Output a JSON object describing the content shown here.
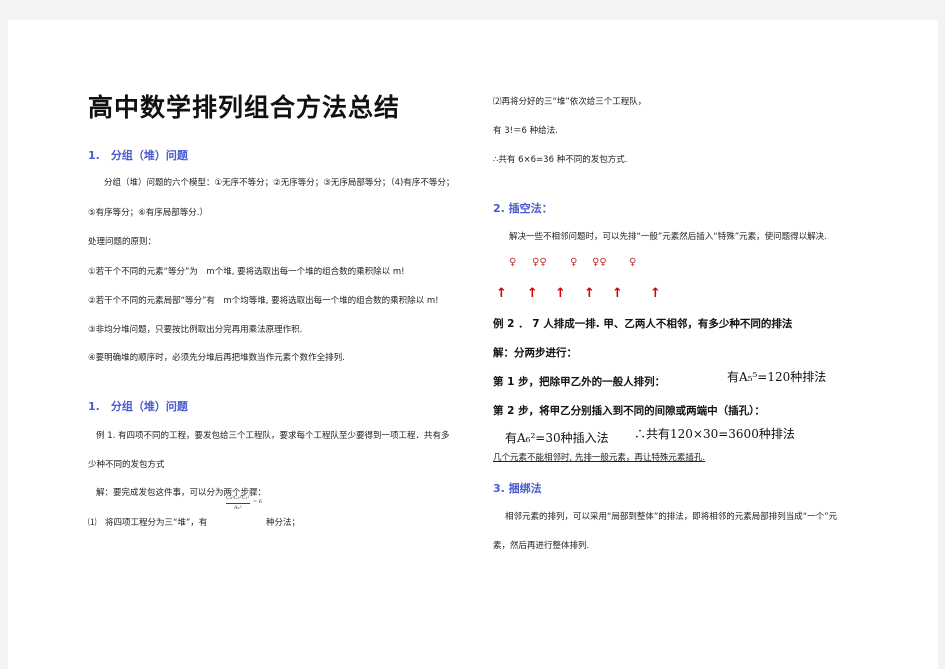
{
  "left": {
    "title": "高中数学排列组合方法总结",
    "s1_heading": "1.　分组（堆）问题",
    "s1_p1a": "分组（堆）问题的六个模型：①无序不等分；②无序等分；③无序局部等分；（4)有序不等分；",
    "s1_p1b": "⑤有序等分；⑥有序局部等分.）",
    "principle": "处理问题的原则：",
    "r1": "①若干个不同的元素“等分”为　m个堆, 要将选取出每一个堆的组合数的乘积除以 m!",
    "r2": "②若干个不同的元素局部“等分”有　m个均等堆, 要将选取出每一个堆的组合数的乘积除以 m!",
    "r3": "③非均分堆问题，只要按比例取出分完再用乘法原理作积.",
    "r4": "④要明确堆的顺序时，必须先分堆后再把堆数当作元素个数作全排列.",
    "s2_heading": "1.　分组（堆）问题",
    "ex1a": "例 1. 有四项不同的工程，要发包给三个工程队，要求每个工程队至少要得到一项工程．共有多",
    "ex1b": "少种不同的发包方式",
    "sol": "解：要完成发包这件事，可以分为两个步骤：",
    "frac_top": "C₄²C₂¹C₁¹",
    "frac_eq": "= 6",
    "frac_bot": "A₂²",
    "step1": "⑴　将四项工程分为三“堆”，有",
    "step1_tail": "种分法；"
  },
  "right": {
    "step2": "⑵再将分好的三“堆”依次给三个工程队，",
    "count1": "有 3!＝6 种给法.",
    "total1": "∴共有 6×6=36 种不同的发包方式.",
    "s3_heading": "2. 插空法：",
    "s3_p": "解决一些不相邻问题时，可以先排“一般”元素然后插入“特殊”元素，使问题得以解决.",
    "symbols": [
      "♀",
      "♀♀",
      "♀",
      "♀♀",
      "♀"
    ],
    "arrows": [
      "↑",
      "↑",
      "↑",
      "↑",
      "↑",
      "↑"
    ],
    "ex2": "例 2 ． 7 人排成一排. 甲、乙两人不相邻，有多少种不同的排法",
    "sol2": "解：分两步进行：",
    "st1": "第 1 步，把除甲乙外的一般人排列：",
    "st1_formula": "有A₅⁵=120种排法",
    "st2": "第 2 步，将甲乙分别插入到不同的间隙或两端中（插孔）：",
    "st2_formula": "有A₆²=30种插入法",
    "total2": "∴共有120×30=3600种排法",
    "note": "几个元素不能相邻时, 先排一般元素，再让特殊元素插孔.",
    "s4_heading": "3. 捆绑法",
    "s4_p1": "相邻元素的排列，可以采用“局部到整体”的排法，即将相邻的元素局部排列当成“一个”元",
    "s4_p2": "素，然后再进行整体排列."
  }
}
